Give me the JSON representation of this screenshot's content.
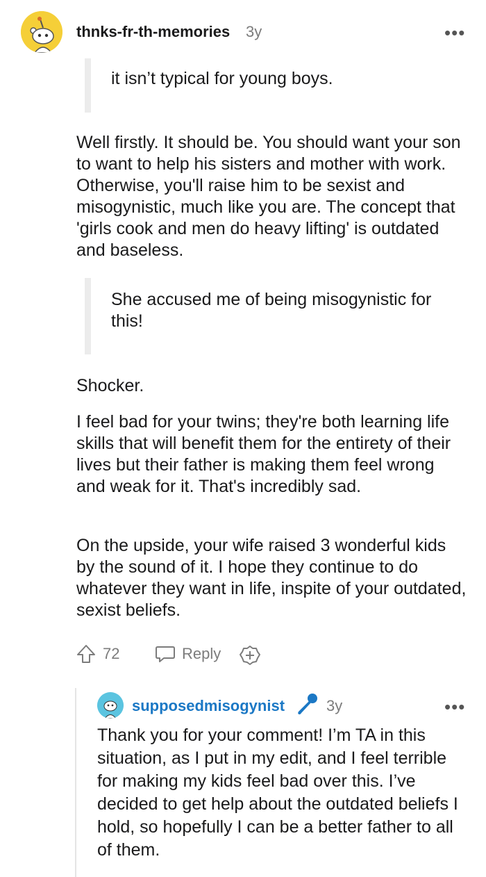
{
  "comment": {
    "author": "thnks-fr-th-memories",
    "age": "3y",
    "more_icon": "more-dots-icon",
    "quote1": "it isn’t typical for young boys.",
    "para1": "Well firstly. It should be. You should want your son to want to help his sisters and mother with work. Otherwise, you'll raise him to be sexist and misogynistic, much like you are. The concept that 'girls cook and men do heavy lifting' is outdated and baseless.",
    "quote2": "She accused me of being misogynistic for this!",
    "para2": "Shocker.",
    "para3": "I feel bad for your twins; they're both learning life skills that will benefit them for the entirety of their lives but their father is making them feel wrong and weak for it. That's incredibly sad.",
    "para4": "On the upside, your wife raised 3 wonderful kids by the sound of it. I hope they continue to do whatever they want in life, inspite of your outdated, sexist beliefs.",
    "votes": "72",
    "reply_label": "Reply"
  },
  "reply": {
    "author": "supposedmisogynist",
    "age": "3y",
    "text": "Thank you for your comment! I’m TA in this situation, as I put in my edit, and I feel terrible for making my kids feel bad over this. I’ve decided to get help about the outdated beliefs I hold, so hopefully I can be a better father to all of them."
  },
  "colors": {
    "avatar_bg": "#f5cf38",
    "op_accent": "#1b78c5",
    "quote_bar": "#ececec",
    "muted": "#7c7c7c"
  }
}
